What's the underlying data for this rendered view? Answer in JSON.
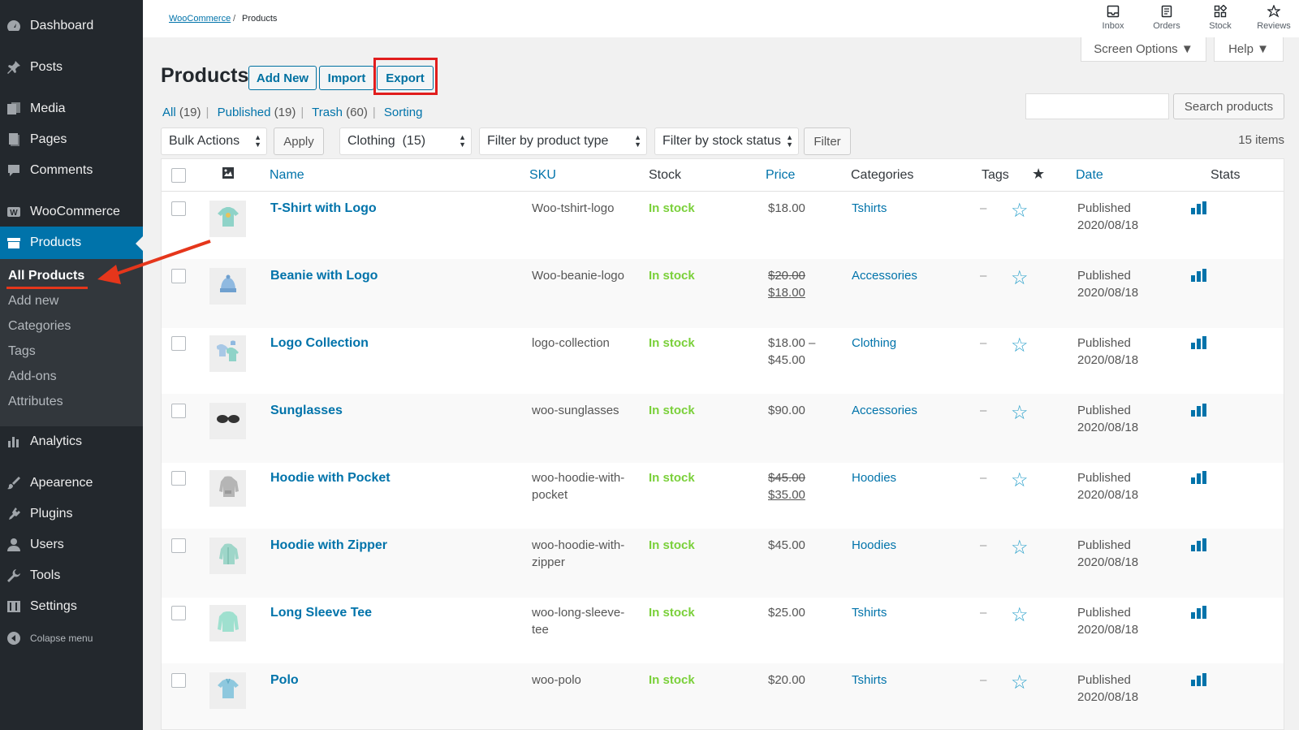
{
  "sidebar": {
    "items": [
      {
        "label": "Dashboard",
        "icon": "dashboard-icon"
      },
      {
        "label": "Posts",
        "icon": "pin-icon"
      },
      {
        "label": "Media",
        "icon": "media-icon"
      },
      {
        "label": "Pages",
        "icon": "pages-icon"
      },
      {
        "label": "Comments",
        "icon": "comment-icon"
      },
      {
        "label": "WooCommerce",
        "icon": "woocommerce-icon"
      },
      {
        "label": "Products",
        "icon": "archive-icon"
      },
      {
        "label": "Analytics",
        "icon": "bar-chart-icon"
      },
      {
        "label": "Apearence",
        "icon": "brush-icon"
      },
      {
        "label": "Plugins",
        "icon": "plugin-icon"
      },
      {
        "label": "Users",
        "icon": "user-icon"
      },
      {
        "label": "Tools",
        "icon": "wrench-icon"
      },
      {
        "label": "Settings",
        "icon": "settings-icon"
      },
      {
        "label": "Colapse menu",
        "icon": "collapse-icon"
      }
    ],
    "submenu": [
      "All Products",
      "Add new",
      "Categories",
      "Tags",
      "Add-ons",
      "Attributes"
    ]
  },
  "breadcrumb": {
    "root": "WooCommerce",
    "separator": "/",
    "current": "Products"
  },
  "toolbar": [
    {
      "label": "Inbox",
      "icon": "inbox-icon"
    },
    {
      "label": "Orders",
      "icon": "orders-icon"
    },
    {
      "label": "Stock",
      "icon": "stock-icon"
    },
    {
      "label": "Reviews",
      "icon": "star-icon"
    }
  ],
  "screen_options": "Screen Options ▼",
  "help": "Help ▼",
  "header": {
    "title": "Products",
    "add_new": "Add New",
    "import": "Import",
    "export": "Export"
  },
  "views": {
    "all": "All",
    "all_count": "(19)",
    "published": "Published",
    "published_count": "(19)",
    "trash": "Trash",
    "trash_count": "(60)",
    "sorting": "Sorting",
    "sep": "|"
  },
  "search": {
    "placeholder": "",
    "button": "Search products"
  },
  "filters": {
    "bulk_actions": "Bulk Actions",
    "apply": "Apply",
    "category": "Clothing  (15)",
    "product_type": "Filter by product type",
    "stock_status": "Filter by stock status",
    "filter": "Filter",
    "items_count": "15 items"
  },
  "table": {
    "columns": {
      "name": "Name",
      "sku": "SKU",
      "stock": "Stock",
      "price": "Price",
      "categories": "Categories",
      "tags": "Tags",
      "featured": "★",
      "date": "Date",
      "stats": "Stats"
    },
    "rows": [
      {
        "name": "T-Shirt with Logo",
        "sku": [
          "Woo-tshirt-logo",
          ""
        ],
        "stock": "In stock",
        "price_old": "",
        "price": "$18.00",
        "category": "Tshirts",
        "tags": "–",
        "date_status": "Published",
        "date": "2020/08/18",
        "thumb": "tshirt"
      },
      {
        "name": "Beanie with Logo",
        "sku": [
          "Woo-beanie-logo",
          ""
        ],
        "stock": "In stock",
        "price_old": "$20.00",
        "price": "$18.00",
        "category": "Accessories",
        "tags": "–",
        "date_status": "Published",
        "date": "2020/08/18",
        "thumb": "beanie"
      },
      {
        "name": "Logo Collection",
        "sku": [
          "logo-collection",
          ""
        ],
        "stock": "In stock",
        "price_old": "",
        "price": "$18.00 –",
        "price2": "$45.00",
        "category": "Clothing",
        "tags": "–",
        "date_status": "Published",
        "date": "2020/08/18",
        "thumb": "collection"
      },
      {
        "name": "Sunglasses",
        "sku": [
          "woo-sunglasses",
          ""
        ],
        "stock": "In stock",
        "price_old": "",
        "price": "$90.00",
        "category": "Accessories",
        "tags": "–",
        "date_status": "Published",
        "date": "2020/08/18",
        "thumb": "sunglasses"
      },
      {
        "name": "Hoodie with Pocket",
        "sku": [
          "woo-hoodie-with-",
          "pocket"
        ],
        "stock": "In stock",
        "price_old": "$45.00",
        "price": "$35.00",
        "category": "Hoodies",
        "tags": "–",
        "date_status": "Published",
        "date": "2020/08/18",
        "thumb": "hoodie-gray"
      },
      {
        "name": "Hoodie with Zipper",
        "sku": [
          "woo-hoodie-with-",
          "zipper"
        ],
        "stock": "In stock",
        "price_old": "",
        "price": "$45.00",
        "category": "Hoodies",
        "tags": "–",
        "date_status": "Published",
        "date": "2020/08/18",
        "thumb": "hoodie"
      },
      {
        "name": "Long Sleeve Tee",
        "sku": [
          "woo-long-sleeve-",
          "tee"
        ],
        "stock": "In stock",
        "price_old": "",
        "price": "$25.00",
        "category": "Tshirts",
        "tags": "–",
        "date_status": "Published",
        "date": "2020/08/18",
        "thumb": "longsleeve"
      },
      {
        "name": "Polo",
        "sku": [
          "woo-polo",
          ""
        ],
        "stock": "In stock",
        "price_old": "",
        "price": "$20.00",
        "category": "Tshirts",
        "tags": "–",
        "date_status": "Published",
        "date": "2020/08/18",
        "thumb": "polo"
      }
    ]
  },
  "colors": {
    "sidebar": "#23282d",
    "accent": "#0073aa",
    "in_stock": "#7ad03a",
    "annotation": "#e11d1d"
  }
}
